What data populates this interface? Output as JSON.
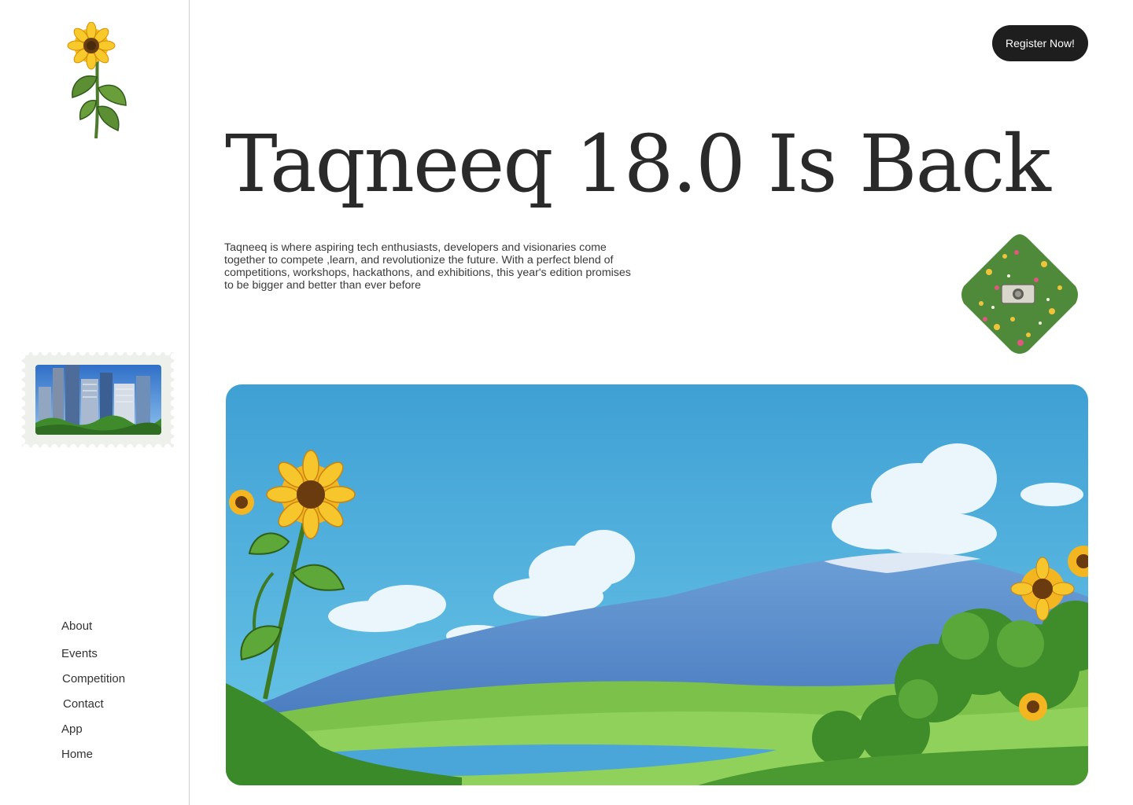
{
  "sidebar": {
    "nav": [
      "About",
      "Events",
      "Competition",
      "Contact",
      "App",
      "Home"
    ]
  },
  "header": {
    "register_label": "Register Now!"
  },
  "hero": {
    "title": "Taqneeq 18.0 Is Back",
    "description": "Taqneeq is where aspiring tech enthusiasts, developers and visionaries come together to compete ,learn, and revolutionize the future. With a perfect blend of competitions, workshops, hackathons, and exhibitions, this year's edition promises to be bigger and better than ever before"
  },
  "colors": {
    "button_bg": "#1e1e1e",
    "sky": "#4fb3dd",
    "mountain": "#4a86c9",
    "grass": "#6fbf3a",
    "sunflower": "#f2b51d"
  },
  "icons": [
    "sunflower-logo",
    "city-stamp",
    "flower-field-diamond",
    "landscape-illustration"
  ]
}
